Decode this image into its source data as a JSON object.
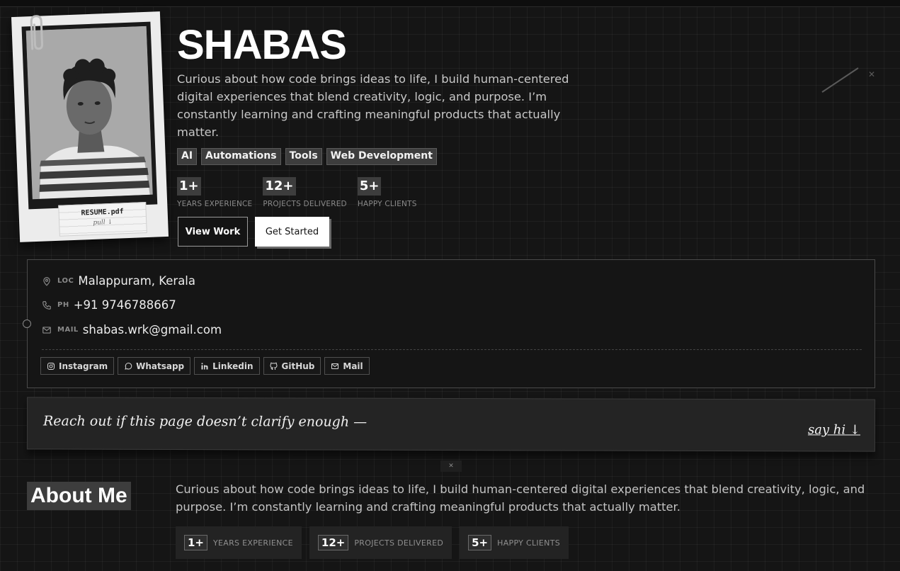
{
  "hero": {
    "name": "SHABAS",
    "bio": "Curious about how code brings ideas to life, I build human-centered digital experiences that blend creativity, logic, and purpose. I’m constantly learning and crafting meaningful products that actually matter.",
    "tags": [
      "AI",
      "Automations",
      "Tools",
      "Web Development"
    ],
    "stats": [
      {
        "value": "1+",
        "label": "YEARS EXPERIENCE"
      },
      {
        "value": "12+",
        "label": "PROJECTS DELIVERED"
      },
      {
        "value": "5+",
        "label": "HAPPY CLIENTS"
      }
    ],
    "buttons": {
      "primary": "View Work",
      "secondary": "Get Started"
    }
  },
  "polaroid": {
    "file": "RESUME.pdf",
    "hint": "pull ↓"
  },
  "contact": {
    "location": {
      "label": "LOC",
      "value": "Malappuram, Kerala",
      "icon": "map-pin-icon"
    },
    "phone": {
      "label": "PH",
      "value": "+91 9746788667",
      "icon": "phone-icon"
    },
    "mail": {
      "label": "MAIL",
      "value": "shabas.wrk@gmail.com",
      "icon": "mail-icon"
    },
    "socials": [
      {
        "label": "Instagram",
        "icon": "instagram-icon"
      },
      {
        "label": "Whatsapp",
        "icon": "whatsapp-icon"
      },
      {
        "label": "Linkedin",
        "icon": "linkedin-icon"
      },
      {
        "label": "GitHub",
        "icon": "github-icon"
      },
      {
        "label": "Mail",
        "icon": "mail-icon"
      }
    ]
  },
  "reach": {
    "text": "Reach out if this page doesn’t clarify enough —",
    "link": "say hi ↓"
  },
  "about": {
    "title": "About Me",
    "bio": "Curious about how code brings ideas to life, I build human-centered digital experiences that blend creativity, logic, and purpose. I’m constantly learning and crafting meaningful products that actually matter.",
    "stats": [
      {
        "value": "1+",
        "label": "YEARS EXPERIENCE"
      },
      {
        "value": "12+",
        "label": "PROJECTS DELIVERED"
      },
      {
        "value": "5+",
        "label": "HAPPY CLIENTS"
      }
    ]
  },
  "colors": {
    "background": "#151515",
    "tag_bg": "#3d3d3d",
    "accent": "#ffffff"
  }
}
